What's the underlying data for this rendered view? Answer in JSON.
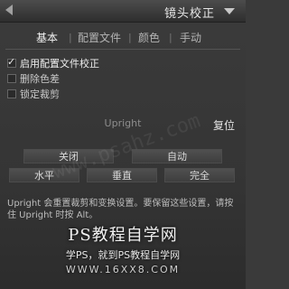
{
  "header": {
    "title": "镜头校正"
  },
  "tabs": [
    {
      "label": "基本",
      "active": true
    },
    {
      "label": "配置文件",
      "active": false
    },
    {
      "label": "颜色",
      "active": false
    },
    {
      "label": "手动",
      "active": false
    }
  ],
  "options": [
    {
      "label": "启用配置文件校正",
      "checked": true
    },
    {
      "label": "删除色差",
      "checked": false
    },
    {
      "label": "锁定裁剪",
      "checked": false
    }
  ],
  "upright": {
    "title": "Upright",
    "reset_label": "复位",
    "buttons": [
      {
        "label": "关闭"
      },
      {
        "label": "自动"
      },
      {
        "label": "水平"
      },
      {
        "label": "垂直"
      },
      {
        "label": "完全"
      }
    ]
  },
  "help_text": "Upright 会重置裁剪和变换设置。要保留这些设置，请按住 Upright 时按 Alt。",
  "watermark": {
    "line1": "PS教程自学网",
    "line2": "学PS，就到PS教程自学网",
    "line3": "WWW.16XX8.COM",
    "diag": "www.psahz.com"
  }
}
